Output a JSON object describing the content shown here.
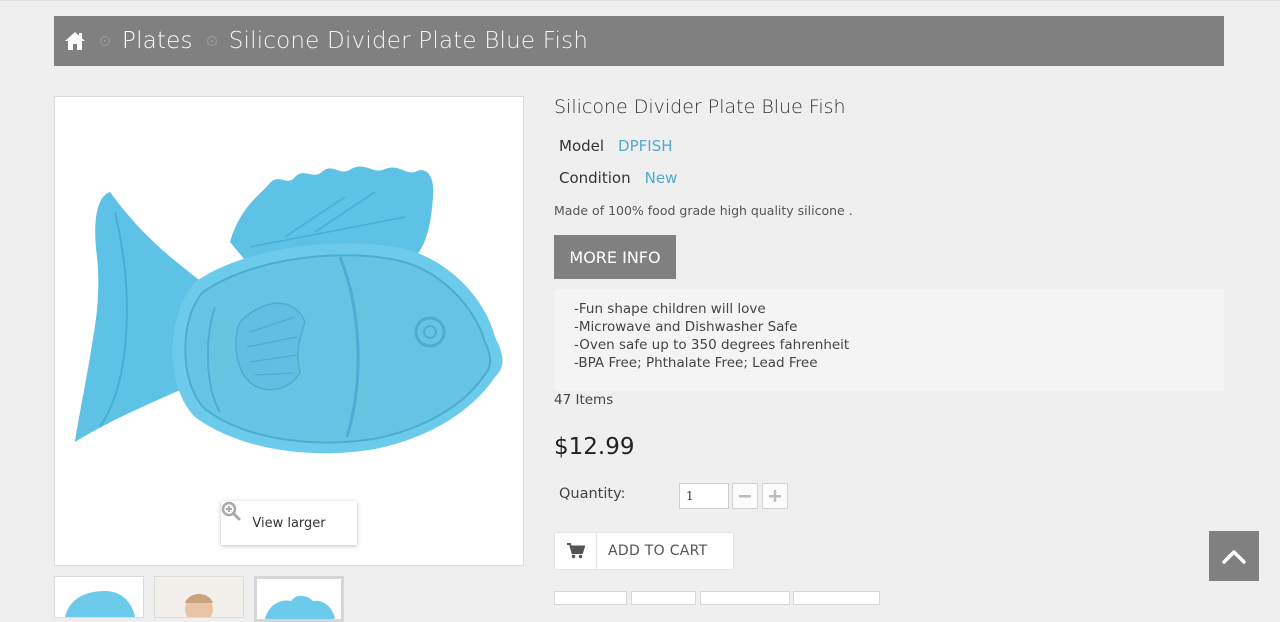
{
  "breadcrumb": {
    "home_icon": "home-icon",
    "items": [
      "Plates",
      "Silicone Divider Plate Blue Fish"
    ]
  },
  "product": {
    "title": "Silicone Divider Plate Blue Fish",
    "model_label": "Model",
    "model_value": "DPFISH",
    "condition_label": "Condition",
    "condition_value": "New",
    "short_description": "Made of 100% food grade high quality silicone .",
    "more_info_label": "MORE INFO",
    "features": [
      "-Fun shape children will love",
      "-Microwave and Dishwasher Safe",
      "-Oven safe up to 350 degrees fahrenheit",
      "-BPA Free; Phthalate Free; Lead Free"
    ],
    "stock": "47 Items",
    "price": "$12.99",
    "quantity_label": "Quantity:",
    "quantity_value": "1",
    "add_to_cart_label": "ADD TO CART"
  },
  "gallery": {
    "view_larger_label": "View larger",
    "thumbnail_count": 3
  },
  "colors": {
    "breadcrumb_bg": "#808080",
    "link_blue": "#4fa8d1",
    "fish_blue": "#6ccbea"
  }
}
